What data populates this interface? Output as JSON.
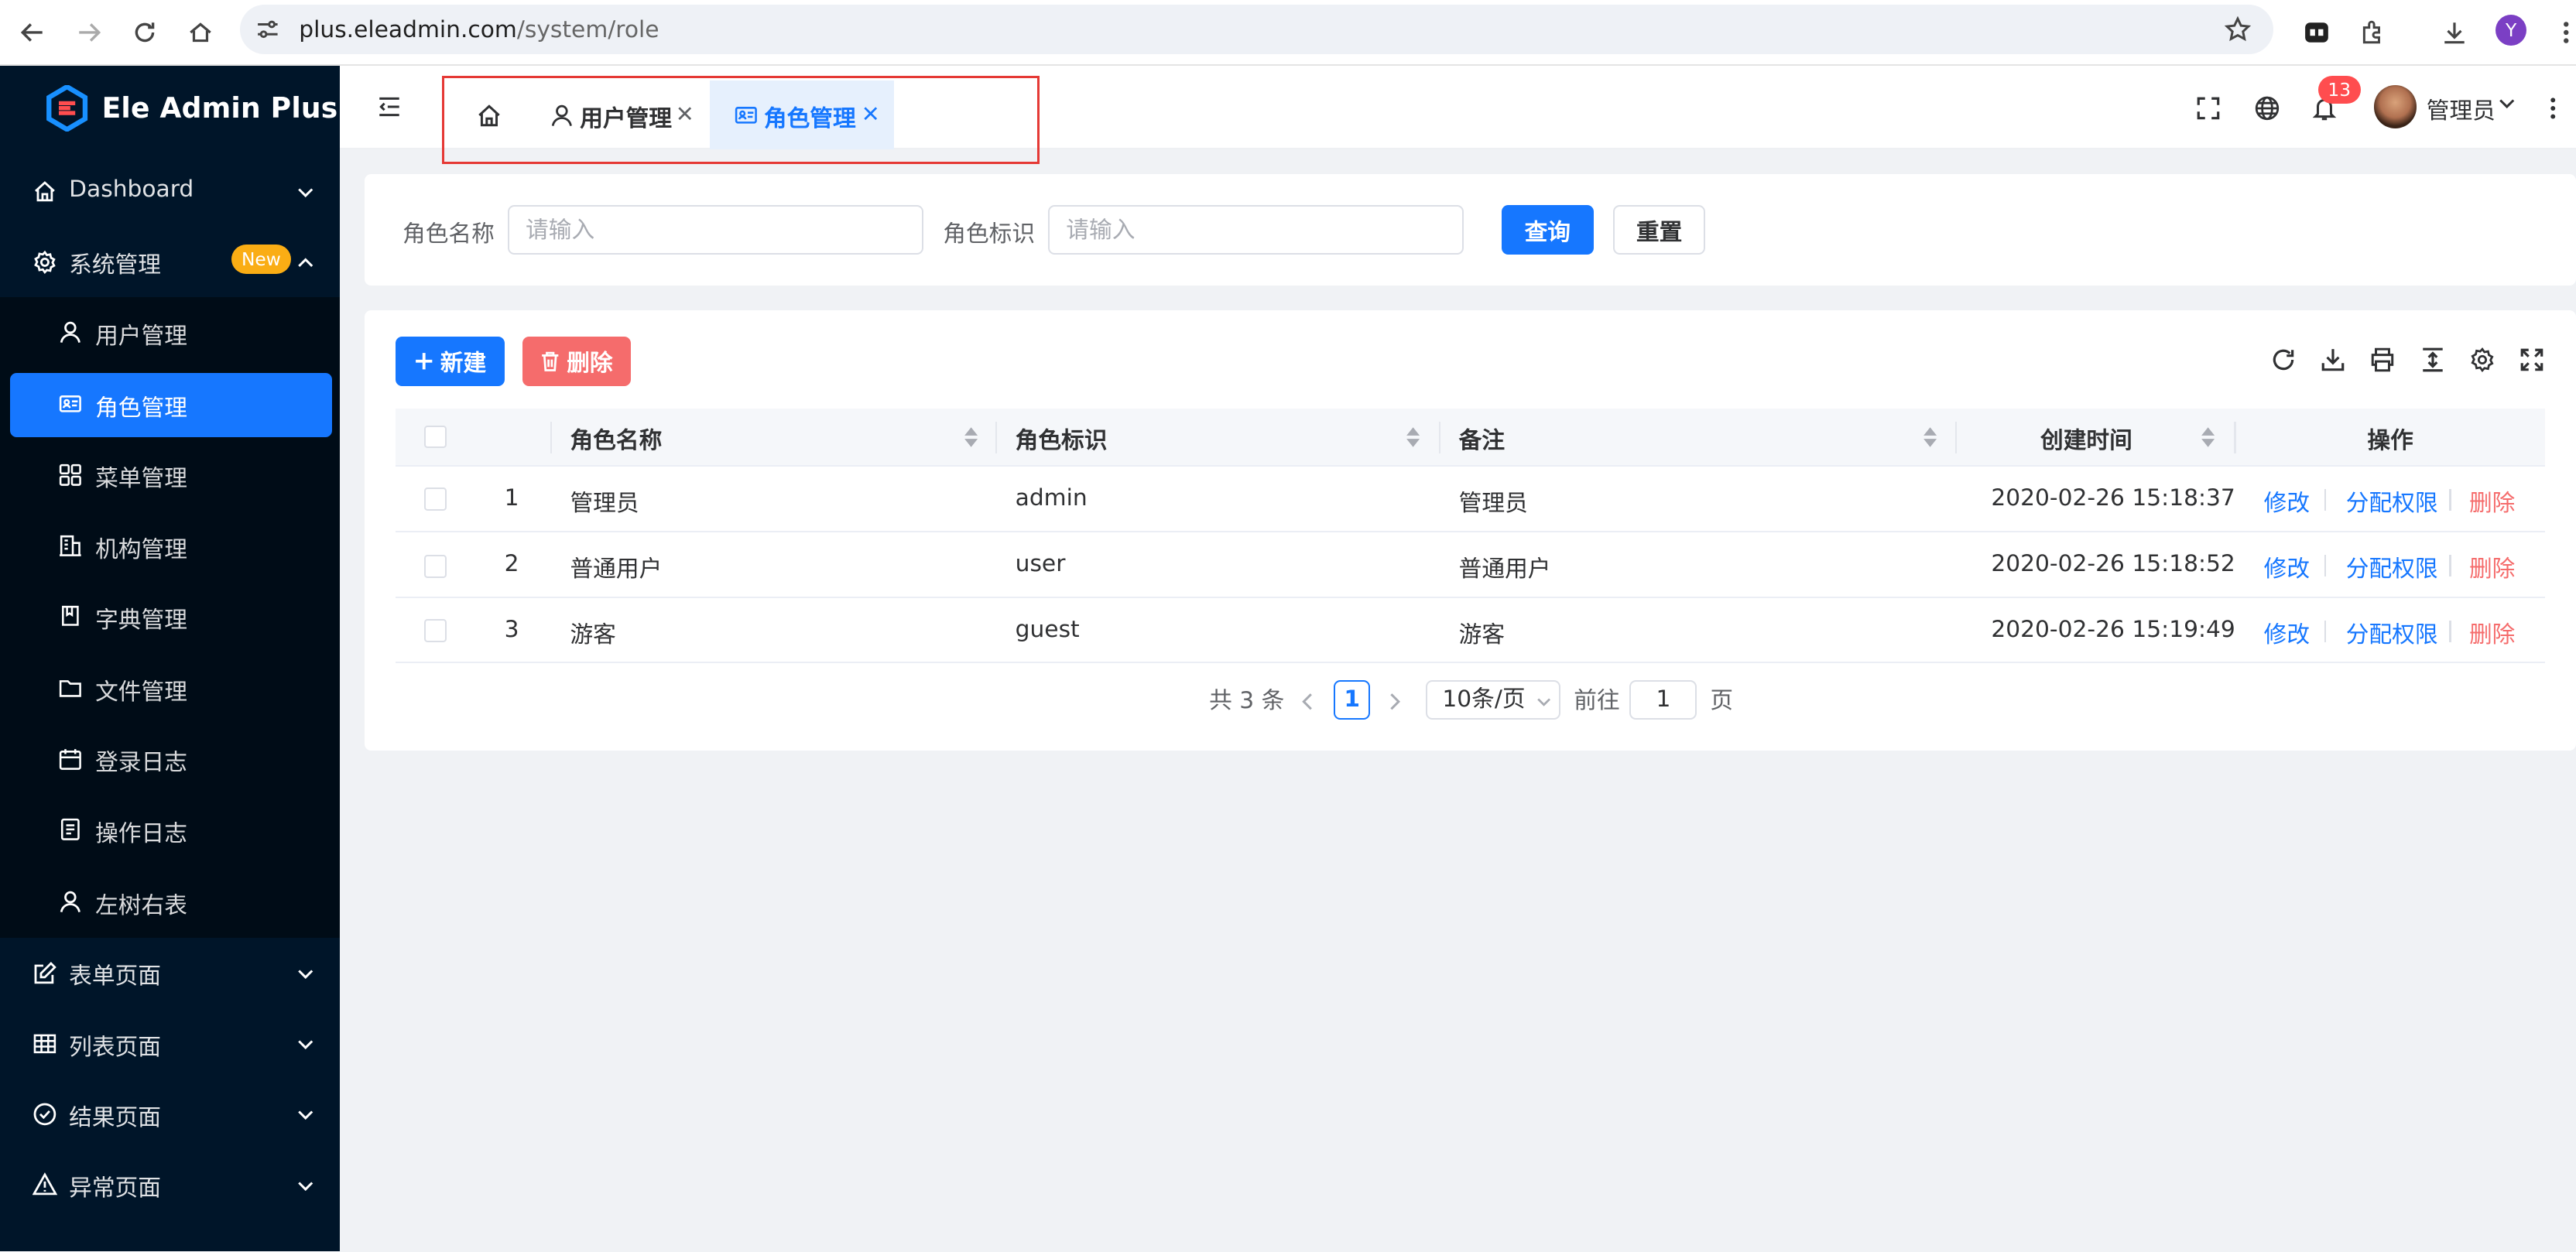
{
  "browser": {
    "host": "plus.eleadmin.com",
    "path": "/system/role",
    "profile_initial": "Y"
  },
  "app": {
    "title": "Ele Admin Plus"
  },
  "sidebar": {
    "menu": [
      {
        "label": "Dashboard",
        "icon": "home-icon"
      },
      {
        "label": "系统管理",
        "icon": "settings-icon",
        "badge": "New"
      },
      {
        "label": "表单页面",
        "icon": "form-icon"
      },
      {
        "label": "列表页面",
        "icon": "table-icon"
      },
      {
        "label": "结果页面",
        "icon": "check-circle-icon"
      },
      {
        "label": "异常页面",
        "icon": "warning-icon"
      }
    ],
    "submenu": [
      {
        "label": "用户管理",
        "icon": "user-icon"
      },
      {
        "label": "角色管理",
        "icon": "id-card-icon",
        "active": true
      },
      {
        "label": "菜单管理",
        "icon": "grid-icon"
      },
      {
        "label": "机构管理",
        "icon": "building-icon"
      },
      {
        "label": "字典管理",
        "icon": "book-icon"
      },
      {
        "label": "文件管理",
        "icon": "folder-icon"
      },
      {
        "label": "登录日志",
        "icon": "calendar-icon"
      },
      {
        "label": "操作日志",
        "icon": "file-text-icon"
      },
      {
        "label": "左树右表",
        "icon": "user-icon"
      }
    ]
  },
  "header": {
    "tabs": [
      {
        "label": "用户管理",
        "icon": "user-icon"
      },
      {
        "label": "角色管理",
        "icon": "id-card-icon",
        "active": true
      }
    ],
    "notification_count": "13",
    "user_name": "管理员"
  },
  "search": {
    "name_label": "角色名称",
    "name_placeholder": "请输入",
    "code_label": "角色标识",
    "code_placeholder": "请输入",
    "query_label": "查询",
    "reset_label": "重置"
  },
  "toolbar": {
    "add_label": "新建",
    "delete_label": "删除"
  },
  "table": {
    "columns": [
      "角色名称",
      "角色标识",
      "备注",
      "创建时间",
      "操作"
    ],
    "rows": [
      {
        "index": "1",
        "name": "管理员",
        "code": "admin",
        "remark": "管理员",
        "created": "2020-02-26 15:18:37"
      },
      {
        "index": "2",
        "name": "普通用户",
        "code": "user",
        "remark": "普通用户",
        "created": "2020-02-26 15:18:52"
      },
      {
        "index": "3",
        "name": "游客",
        "code": "guest",
        "remark": "游客",
        "created": "2020-02-26 15:19:49"
      }
    ],
    "actions": {
      "edit": "修改",
      "assign": "分配权限",
      "delete": "删除"
    }
  },
  "pagination": {
    "total_text": "共 3 条",
    "current_page": "1",
    "page_size": "10条/页",
    "goto_prefix": "前往",
    "goto_value": "1",
    "goto_suffix": "页"
  },
  "colors": {
    "primary": "#1677ff",
    "danger": "#f56c6c",
    "sidebar_bg": "#001529",
    "badge_new": "#faad14",
    "badge_count": "#ff4d4f"
  }
}
